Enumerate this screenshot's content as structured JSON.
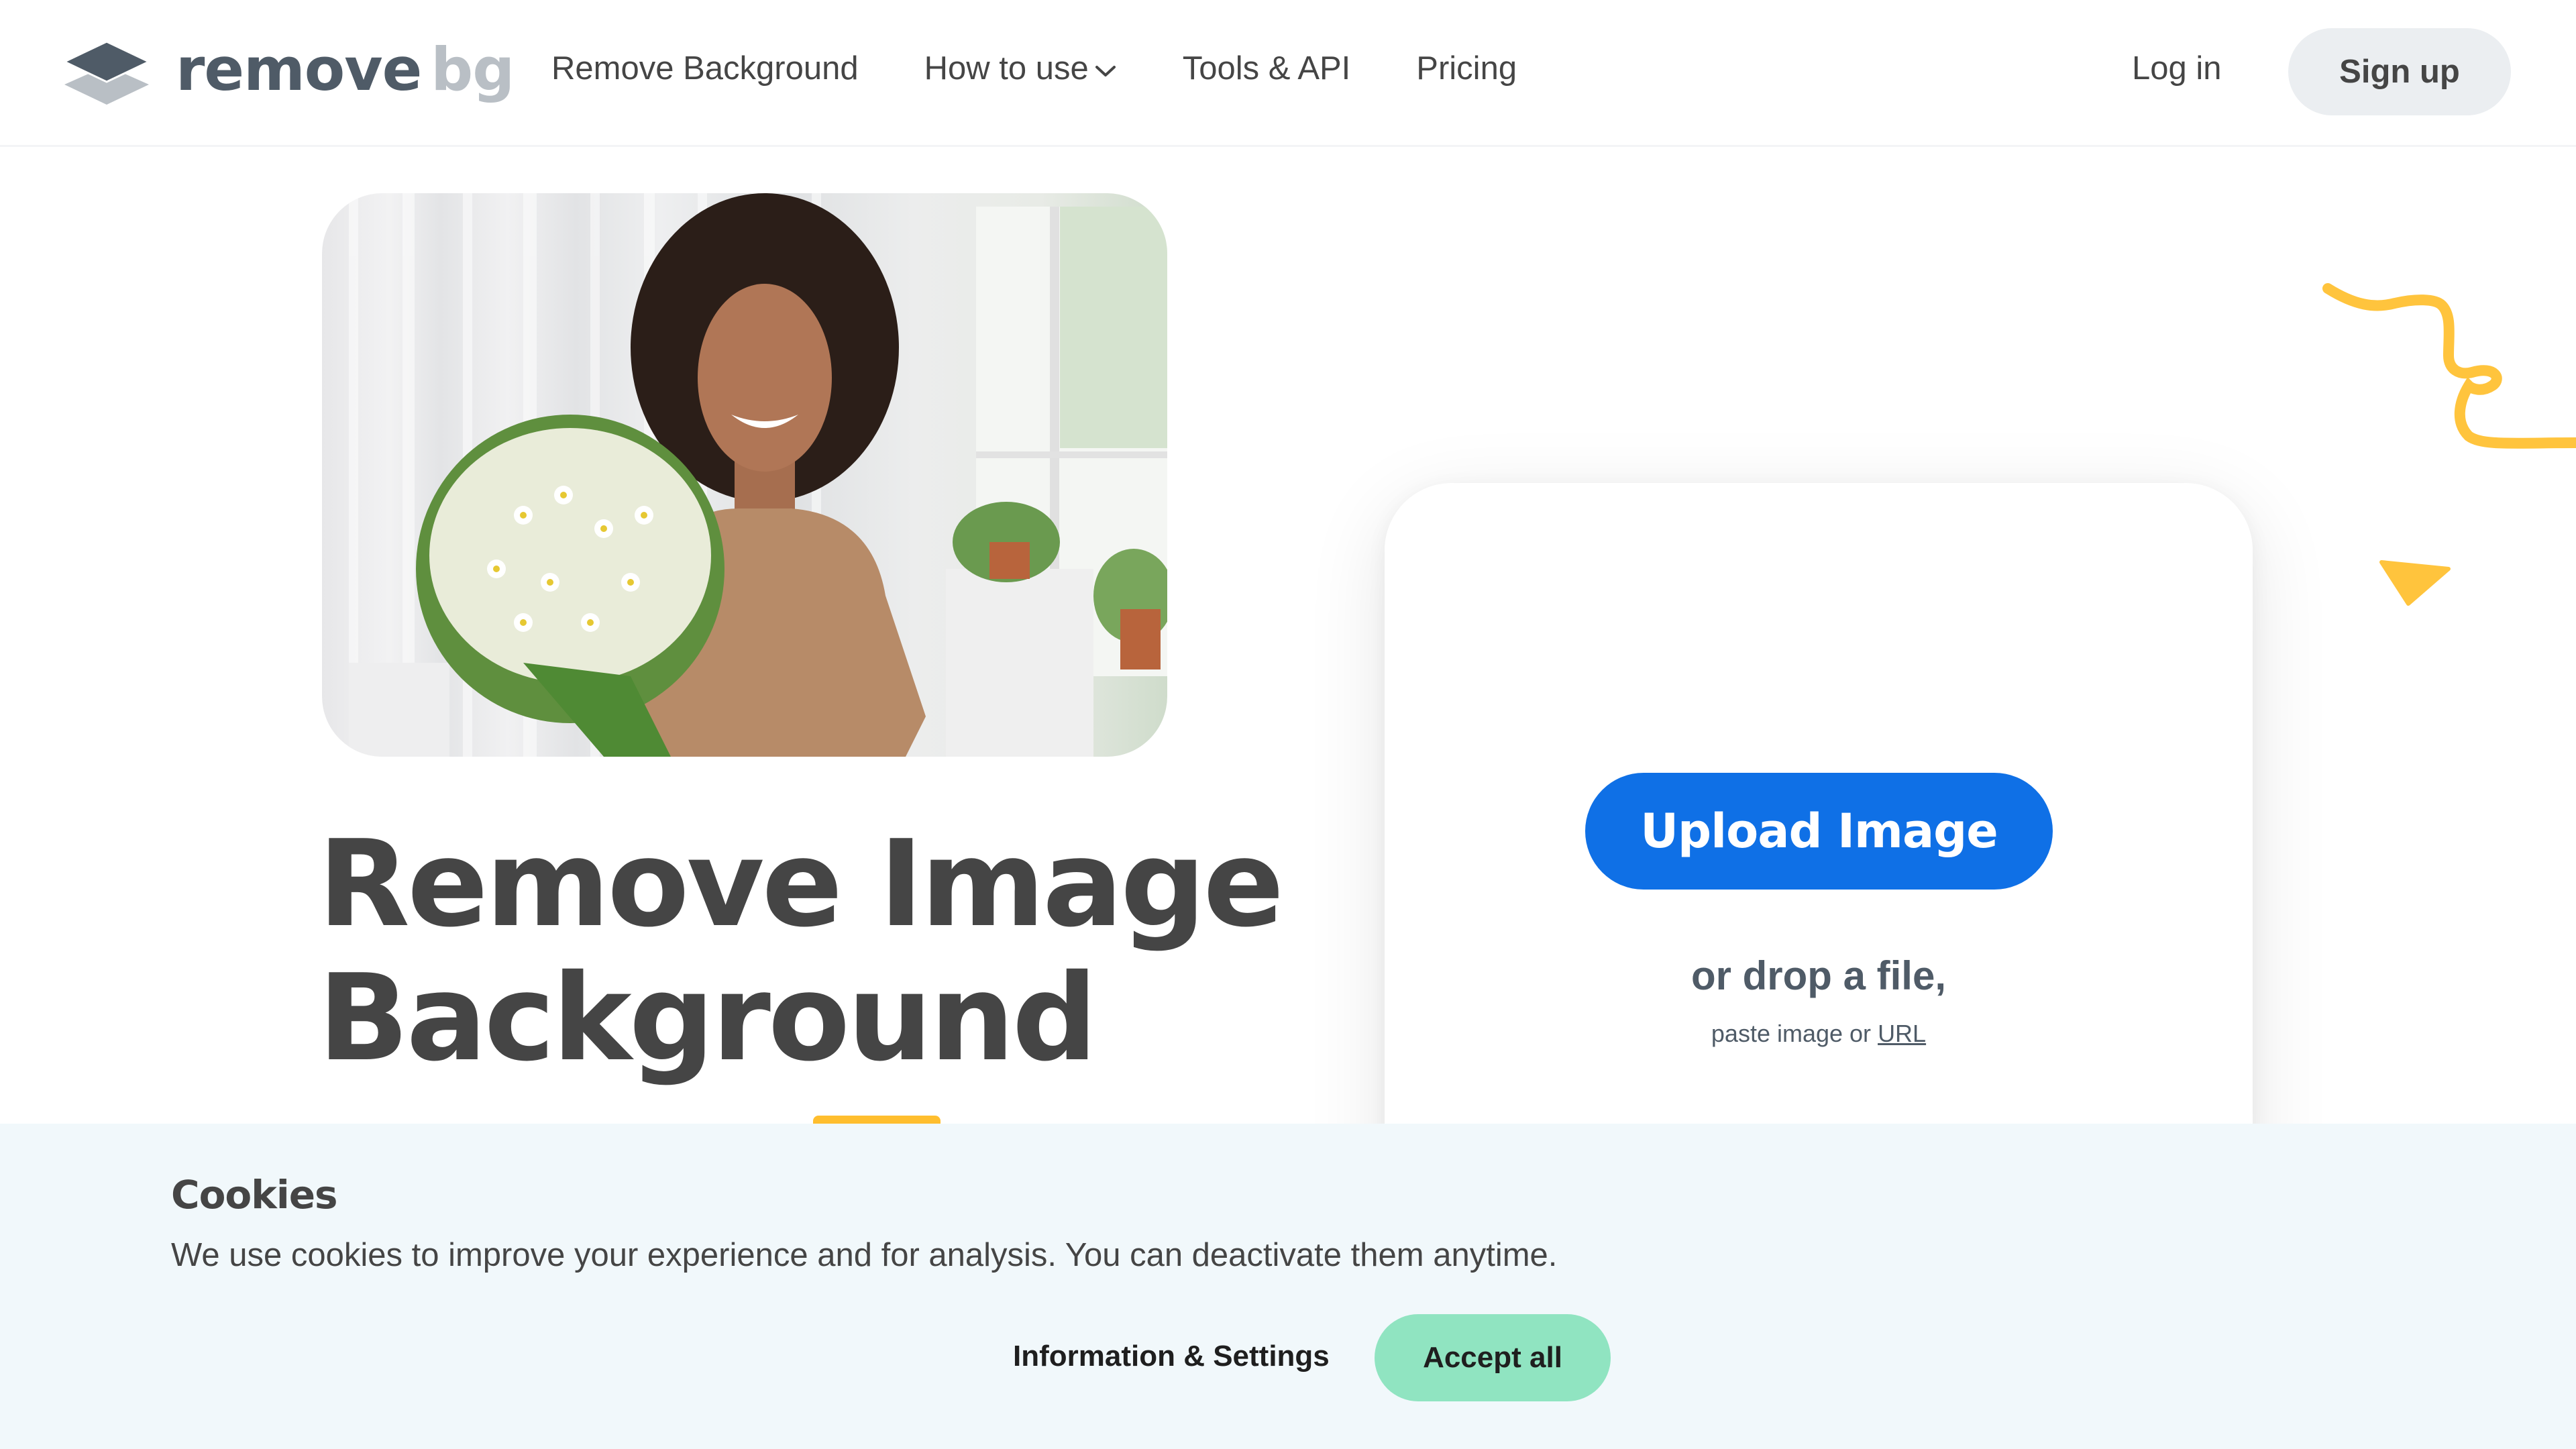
{
  "brand": {
    "name_part1": "remove",
    "name_part2": "bg",
    "logo_icon": "layers-diamond-icon",
    "colors": {
      "primary_dark": "#4f5b67",
      "secondary_light": "#b9bfc5"
    }
  },
  "nav": {
    "items": [
      {
        "label": "Remove Background",
        "has_dropdown": false
      },
      {
        "label": "How to use",
        "has_dropdown": true,
        "icon": "chevron-down-icon"
      },
      {
        "label": "Tools & API",
        "has_dropdown": false
      },
      {
        "label": "Pricing",
        "has_dropdown": false
      }
    ],
    "login_label": "Log in",
    "signup_label": "Sign up"
  },
  "hero": {
    "photo_description": "Smiling woman with curly hair in a tan blouse holding a bouquet of white chamomile flowers in a bright room",
    "headline_line1": "Remove Image",
    "headline_line2": "Background"
  },
  "upload_card": {
    "upload_button_label": "Upload Image",
    "drop_text": "or drop a file,",
    "paste_text": "paste image or",
    "url_link_label": "URL"
  },
  "cookie_banner": {
    "title": "Cookies",
    "message": "We use cookies to improve your experience and for analysis. You can deactivate them anytime.",
    "info_settings_label": "Information & Settings",
    "accept_all_label": "Accept all"
  },
  "colors": {
    "upload_button": "#0f70e6",
    "accept_button": "#90e4c1",
    "signup_button": "#ebeef1",
    "accent_yellow": "#ffc43d",
    "cookie_banner_bg": "#f1f8fb",
    "text_dark": "#454545"
  }
}
